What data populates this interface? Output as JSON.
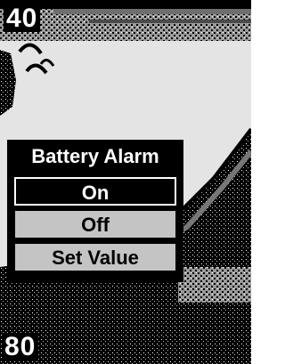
{
  "scale": {
    "top": "40",
    "bottom": "80"
  },
  "menu": {
    "title": "Battery Alarm",
    "items": [
      {
        "label": "On",
        "selected": true
      },
      {
        "label": "Off",
        "selected": false
      },
      {
        "label": "Set Value",
        "selected": false
      }
    ]
  },
  "colors": {
    "background": "#e4e4e4",
    "bottom": "#000000",
    "menu_bg": "#000000",
    "item_bg": "#c4c4c4"
  },
  "icons": [
    "fish-arch-icon"
  ]
}
